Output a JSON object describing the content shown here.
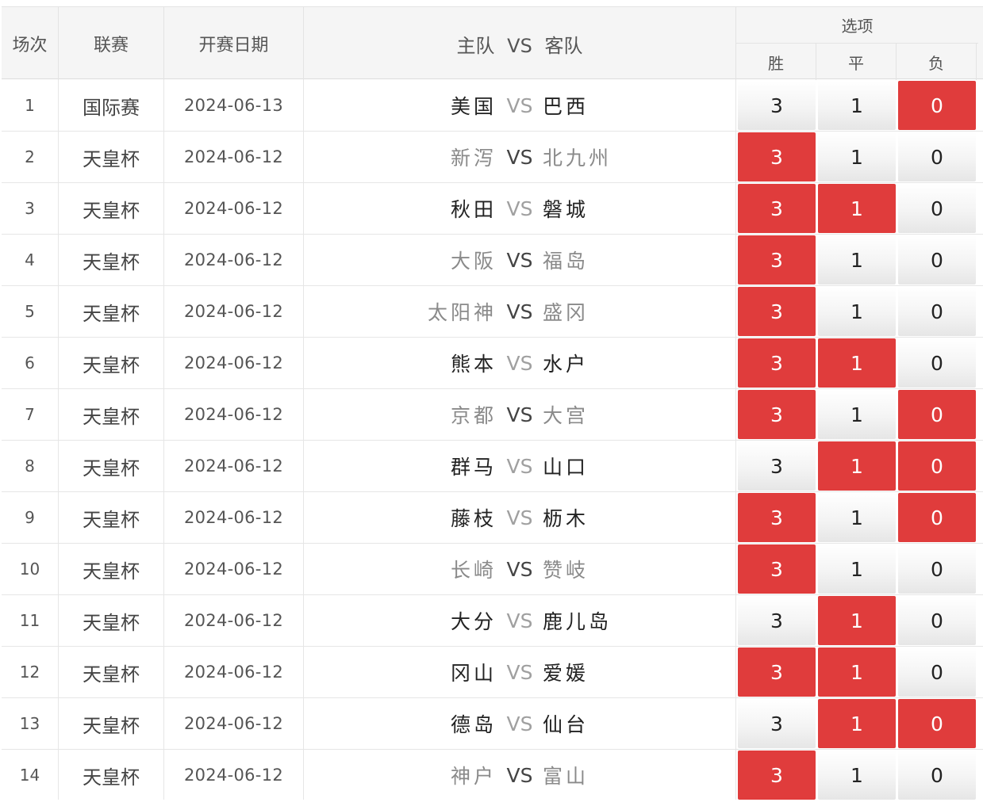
{
  "header": {
    "idx": "场次",
    "league": "联赛",
    "date": "开赛日期",
    "match": "主队 VS 客队",
    "options_title": "选项",
    "options": [
      "胜",
      "平",
      "负"
    ]
  },
  "colors": {
    "selected": "#e03c3c",
    "muted_team": "#8a8a8a"
  },
  "rows": [
    {
      "idx": "1",
      "league": "国际赛",
      "date": "2024-06-13",
      "home": "美国",
      "vs": "VS",
      "away": "巴西",
      "muted": false,
      "o0": "3",
      "o1": "1",
      "o2": "0",
      "sel": [
        false,
        false,
        true
      ]
    },
    {
      "idx": "2",
      "league": "天皇杯",
      "date": "2024-06-12",
      "home": "新泻",
      "vs": "VS",
      "away": "北九州",
      "muted": true,
      "o0": "3",
      "o1": "1",
      "o2": "0",
      "sel": [
        true,
        false,
        false
      ]
    },
    {
      "idx": "3",
      "league": "天皇杯",
      "date": "2024-06-12",
      "home": "秋田",
      "vs": "VS",
      "away": "磐城",
      "muted": false,
      "o0": "3",
      "o1": "1",
      "o2": "0",
      "sel": [
        true,
        true,
        false
      ]
    },
    {
      "idx": "4",
      "league": "天皇杯",
      "date": "2024-06-12",
      "home": "大阪",
      "vs": "VS",
      "away": "福岛",
      "muted": true,
      "o0": "3",
      "o1": "1",
      "o2": "0",
      "sel": [
        true,
        false,
        false
      ]
    },
    {
      "idx": "5",
      "league": "天皇杯",
      "date": "2024-06-12",
      "home": "太阳神",
      "vs": "VS",
      "away": "盛冈",
      "muted": true,
      "o0": "3",
      "o1": "1",
      "o2": "0",
      "sel": [
        true,
        false,
        false
      ]
    },
    {
      "idx": "6",
      "league": "天皇杯",
      "date": "2024-06-12",
      "home": "熊本",
      "vs": "VS",
      "away": "水户",
      "muted": false,
      "o0": "3",
      "o1": "1",
      "o2": "0",
      "sel": [
        true,
        true,
        false
      ]
    },
    {
      "idx": "7",
      "league": "天皇杯",
      "date": "2024-06-12",
      "home": "京都",
      "vs": "VS",
      "away": "大宫",
      "muted": true,
      "o0": "3",
      "o1": "1",
      "o2": "0",
      "sel": [
        true,
        false,
        true
      ]
    },
    {
      "idx": "8",
      "league": "天皇杯",
      "date": "2024-06-12",
      "home": "群马",
      "vs": "VS",
      "away": "山口",
      "muted": false,
      "o0": "3",
      "o1": "1",
      "o2": "0",
      "sel": [
        false,
        true,
        true
      ]
    },
    {
      "idx": "9",
      "league": "天皇杯",
      "date": "2024-06-12",
      "home": "藤枝",
      "vs": "VS",
      "away": "枥木",
      "muted": false,
      "o0": "3",
      "o1": "1",
      "o2": "0",
      "sel": [
        true,
        false,
        true
      ]
    },
    {
      "idx": "10",
      "league": "天皇杯",
      "date": "2024-06-12",
      "home": "长崎",
      "vs": "VS",
      "away": "赞岐",
      "muted": true,
      "o0": "3",
      "o1": "1",
      "o2": "0",
      "sel": [
        true,
        false,
        false
      ]
    },
    {
      "idx": "11",
      "league": "天皇杯",
      "date": "2024-06-12",
      "home": "大分",
      "vs": "VS",
      "away": "鹿儿岛",
      "muted": false,
      "o0": "3",
      "o1": "1",
      "o2": "0",
      "sel": [
        false,
        true,
        false
      ]
    },
    {
      "idx": "12",
      "league": "天皇杯",
      "date": "2024-06-12",
      "home": "冈山",
      "vs": "VS",
      "away": "爱媛",
      "muted": false,
      "o0": "3",
      "o1": "1",
      "o2": "0",
      "sel": [
        true,
        true,
        false
      ]
    },
    {
      "idx": "13",
      "league": "天皇杯",
      "date": "2024-06-12",
      "home": "德岛",
      "vs": "VS",
      "away": "仙台",
      "muted": false,
      "o0": "3",
      "o1": "1",
      "o2": "0",
      "sel": [
        false,
        true,
        true
      ]
    },
    {
      "idx": "14",
      "league": "天皇杯",
      "date": "2024-06-12",
      "home": "神户",
      "vs": "VS",
      "away": "富山",
      "muted": true,
      "o0": "3",
      "o1": "1",
      "o2": "0",
      "sel": [
        true,
        false,
        false
      ]
    }
  ]
}
